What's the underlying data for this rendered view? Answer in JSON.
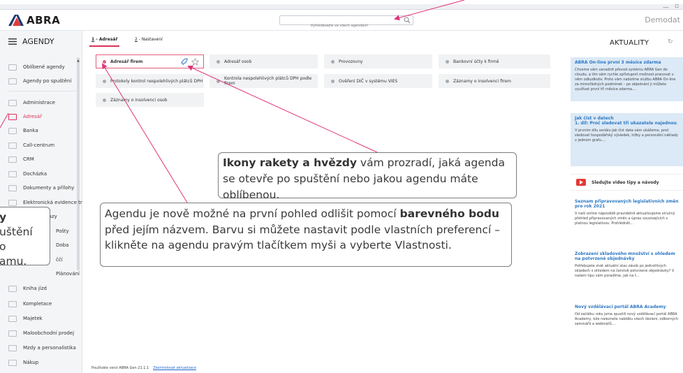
{
  "app": {
    "logo_text": "ABRA",
    "search_placeholder": "Vyhledávejte ve všech agendách",
    "user_label": "Demodat"
  },
  "sidebar": {
    "title": "AGENDY",
    "top_items": [
      {
        "label": "Oblíbené agendy"
      },
      {
        "label": "Agendy po spuštění"
      }
    ],
    "items": [
      {
        "label": "Administrace"
      },
      {
        "label": "Adresář",
        "active": true
      },
      {
        "label": "Banka"
      },
      {
        "label": "Call-centrum"
      },
      {
        "label": "CRM"
      },
      {
        "label": "Docházka"
      },
      {
        "label": "Dokumenty a přílohy"
      },
      {
        "label": "Elektronická evidence tr"
      },
      {
        "label": "Interní vzkazy"
      },
      {
        "label": "Pošty"
      },
      {
        "label": "Doba"
      },
      {
        "label": "ččí"
      },
      {
        "label": "Plánování"
      },
      {
        "label": "Kniha jízd"
      },
      {
        "label": "Kompletace"
      },
      {
        "label": "Majetek"
      },
      {
        "label": "Maloobchodní prodej"
      },
      {
        "label": "Mzdy a personalistika"
      },
      {
        "label": "Nákup"
      }
    ]
  },
  "tabs": [
    {
      "key": "1",
      "label": "Adresář",
      "active": true
    },
    {
      "key": "2",
      "label": "Nastavení",
      "active": false
    }
  ],
  "tiles": [
    {
      "label": "Adresář firem",
      "selected": true
    },
    {
      "label": "Adresář osob"
    },
    {
      "label": "Provozovny"
    },
    {
      "label": "Bankovní účty k firmě"
    },
    {
      "label": "Protokoly kontrol nespolehlivých plátců DPH"
    },
    {
      "label": "Kontrola nespolehlivých plátců DPH podle firem"
    },
    {
      "label": "Ověření DIČ v systému VIES"
    },
    {
      "label": "Záznamy o insolvenci firem"
    },
    {
      "label": "Záznamy o insolvenci osob"
    }
  ],
  "footer": {
    "version_text": "Používáte verzi ABRA Gen 21.1.1",
    "update_link": "Zkontrolovat aktualizace"
  },
  "news": {
    "title": "AKTUALITY",
    "cards": [
      {
        "title": "ABRA On-line první 3 měsíce zdarma",
        "body": "Chceme vám usnadnit převod systému ABRA Gen do cloudu, a tím vám rychle zpřístupnit možnost pracovat v něm odkudkoliv. Proto vám nabízíme službu ABRA On-line za mimořádných podmínek – po objednání ji můžete využívat první tři měsíce zdarma...."
      },
      {
        "title": "Jak číst v datech\n1. díl: Proč sledovat tři ukazatele najednou",
        "body": "V prvním dílu seriálu Jak číst data vám ukážeme, proč sledovat hospodářský výsledek, tržby a personální náklady v jednom grafu...."
      },
      {
        "title": "Seznam připravovaných legislativních změn pro rok 2021",
        "body": "V naší online nápovědě pravidelně aktualizujeme stručný přehled připravovaných změn a úprav souvisejících s platnou legislativou. Prohlédnět..."
      },
      {
        "title": "Zobrazení skladového množství s ohledem na potvrzené objednávky",
        "body": "Potřebujete znát aktuální stav zásob po jednotlivých skladech s ohledem na čerstvě potvrzené objednávky? V našem tipu vám poradíme, jak na t..."
      },
      {
        "title": "Nový vzdělávací portál ABRA Academy",
        "body": "Od začátku roku jsme spustili nový vzdělávací portál ABRA Academy, kde naleznete nabídku všech školení, odborných seminářů a webinářů...."
      }
    ],
    "video_label": "Sledujte video tipy a návody"
  },
  "callouts": {
    "rocket_star": {
      "bold": "Ikony rakety a hvězdy",
      "rest": " vám prozradí, jaká agenda se otevře po spuštění nebo jakou agendu máte oblíbenou."
    },
    "color_dot": {
      "pre": "Agendu je nově možné na první pohled odlišit pomocí ",
      "bold": "barevného bodu",
      "post": " před jejím názvem. Barvu si můžete nastavit podle vlastních preferencí – klikněte na agendu pravým tlačítkem myši a vyberte Vlastnosti."
    },
    "left_partial": {
      "bold": "y",
      "line2": "uštění",
      "line3": "o",
      "line4": "amu."
    }
  },
  "colors": {
    "accent": "#d9335a",
    "callout_arrow": "#e0337a",
    "news_link": "#2c78c4",
    "news_card_bg": "#dce9f6"
  }
}
